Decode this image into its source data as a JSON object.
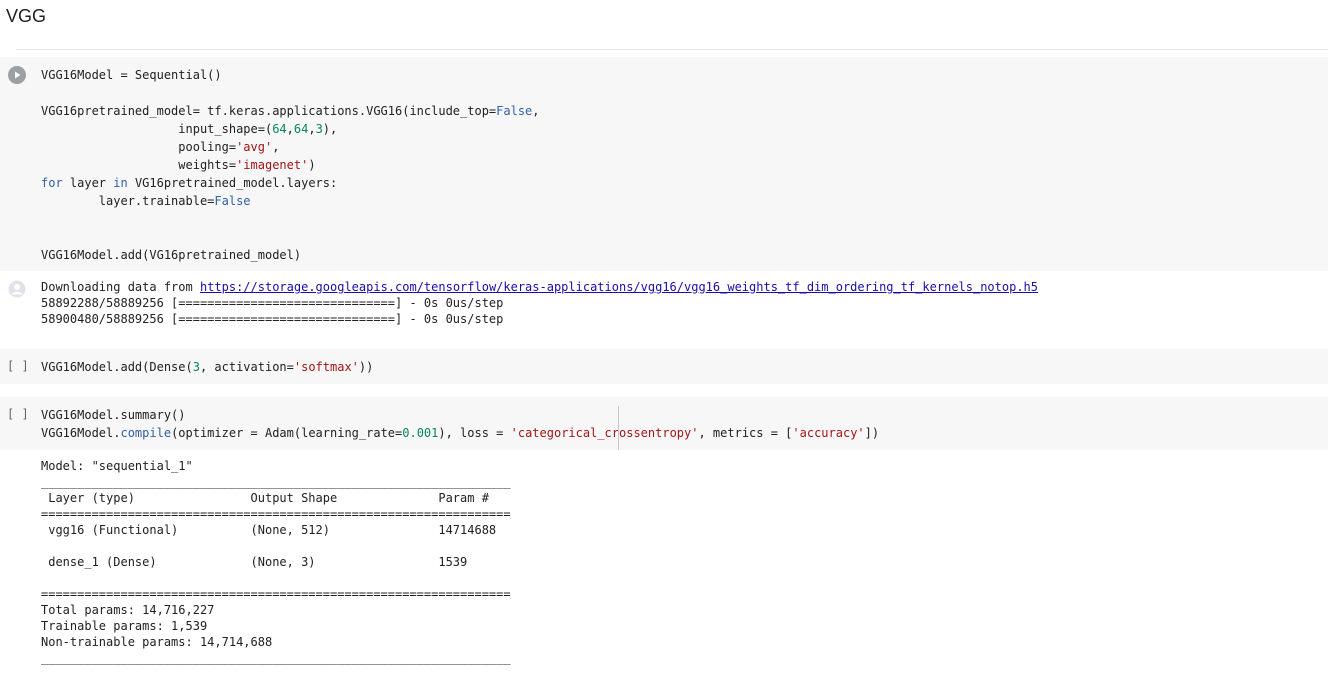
{
  "section": {
    "title": "VGG"
  },
  "cells": [
    {
      "state": "ran",
      "code": [
        [
          [
            "VGG16Model = Sequential()",
            "p"
          ]
        ],
        [],
        [
          [
            "VGG16pretrained_model= tf.keras.applications.VGG16(include_top=",
            "p"
          ],
          [
            "False",
            "kw"
          ],
          [
            ",",
            "p"
          ]
        ],
        [
          [
            "                   input_shape=(",
            "p"
          ],
          [
            "64",
            "num"
          ],
          [
            ",",
            "p"
          ],
          [
            "64",
            "num"
          ],
          [
            ",",
            "p"
          ],
          [
            "3",
            "num"
          ],
          [
            "),",
            "p"
          ]
        ],
        [
          [
            "                   pooling=",
            "p"
          ],
          [
            "'avg'",
            "str"
          ],
          [
            ",",
            "p"
          ]
        ],
        [
          [
            "                   weights=",
            "p"
          ],
          [
            "'imagenet'",
            "str"
          ],
          [
            ")",
            "p"
          ]
        ],
        [
          [
            "for",
            "kw"
          ],
          [
            " layer ",
            "p"
          ],
          [
            "in",
            "kw"
          ],
          [
            " VG16pretrained_model.layers:",
            "p"
          ]
        ],
        [
          [
            "        layer.trainable=",
            "p"
          ],
          [
            "False",
            "kw"
          ]
        ],
        [],
        [],
        [
          [
            "VGG16Model.add(VG16pretrained_model)",
            "p"
          ]
        ]
      ],
      "output": {
        "download_prefix": "Downloading data from ",
        "download_url": "https://storage.googleapis.com/tensorflow/keras-applications/vgg16/vgg16_weights_tf_dim_ordering_tf_kernels_notop.h5",
        "progress_lines": [
          "58892288/58889256 [==============================] - 0s 0us/step",
          "58900480/58889256 [==============================] - 0s 0us/step"
        ]
      }
    },
    {
      "state": "idle",
      "bracket": "[ ]",
      "code": [
        [
          [
            "VGG16Model.add(Dense(",
            "p"
          ],
          [
            "3",
            "num"
          ],
          [
            ", activation=",
            "p"
          ],
          [
            "'softmax'",
            "str"
          ],
          [
            "))",
            "p"
          ]
        ]
      ]
    },
    {
      "state": "idle",
      "bracket": "[ ]",
      "code": [
        [
          [
            "VGG16Model.summary()",
            "p"
          ]
        ],
        [
          [
            "VGG16Model.",
            "p"
          ],
          [
            "compile",
            "kw"
          ],
          [
            "(optimizer = Adam(learning_rate=",
            "p"
          ],
          [
            "0.001",
            "num"
          ],
          [
            "), loss = ",
            "p"
          ],
          [
            "'categorical_crossentropy'",
            "str"
          ],
          [
            ", metrics = [",
            "p"
          ],
          [
            "'accuracy'",
            "str"
          ],
          [
            "])",
            "p"
          ]
        ]
      ],
      "output_lines": [
        "Model: \"sequential_1\"",
        "_________________________________________________________________",
        " Layer (type)                Output Shape              Param #   ",
        "=================================================================",
        " vgg16 (Functional)          (None, 512)               14714688  ",
        "",
        " dense_1 (Dense)             (None, 3)                 1539      ",
        "",
        "=================================================================",
        "Total params: 14,716,227",
        "Trainable params: 1,539",
        "Non-trainable params: 14,714,688",
        "_________________________________________________________________"
      ]
    }
  ]
}
